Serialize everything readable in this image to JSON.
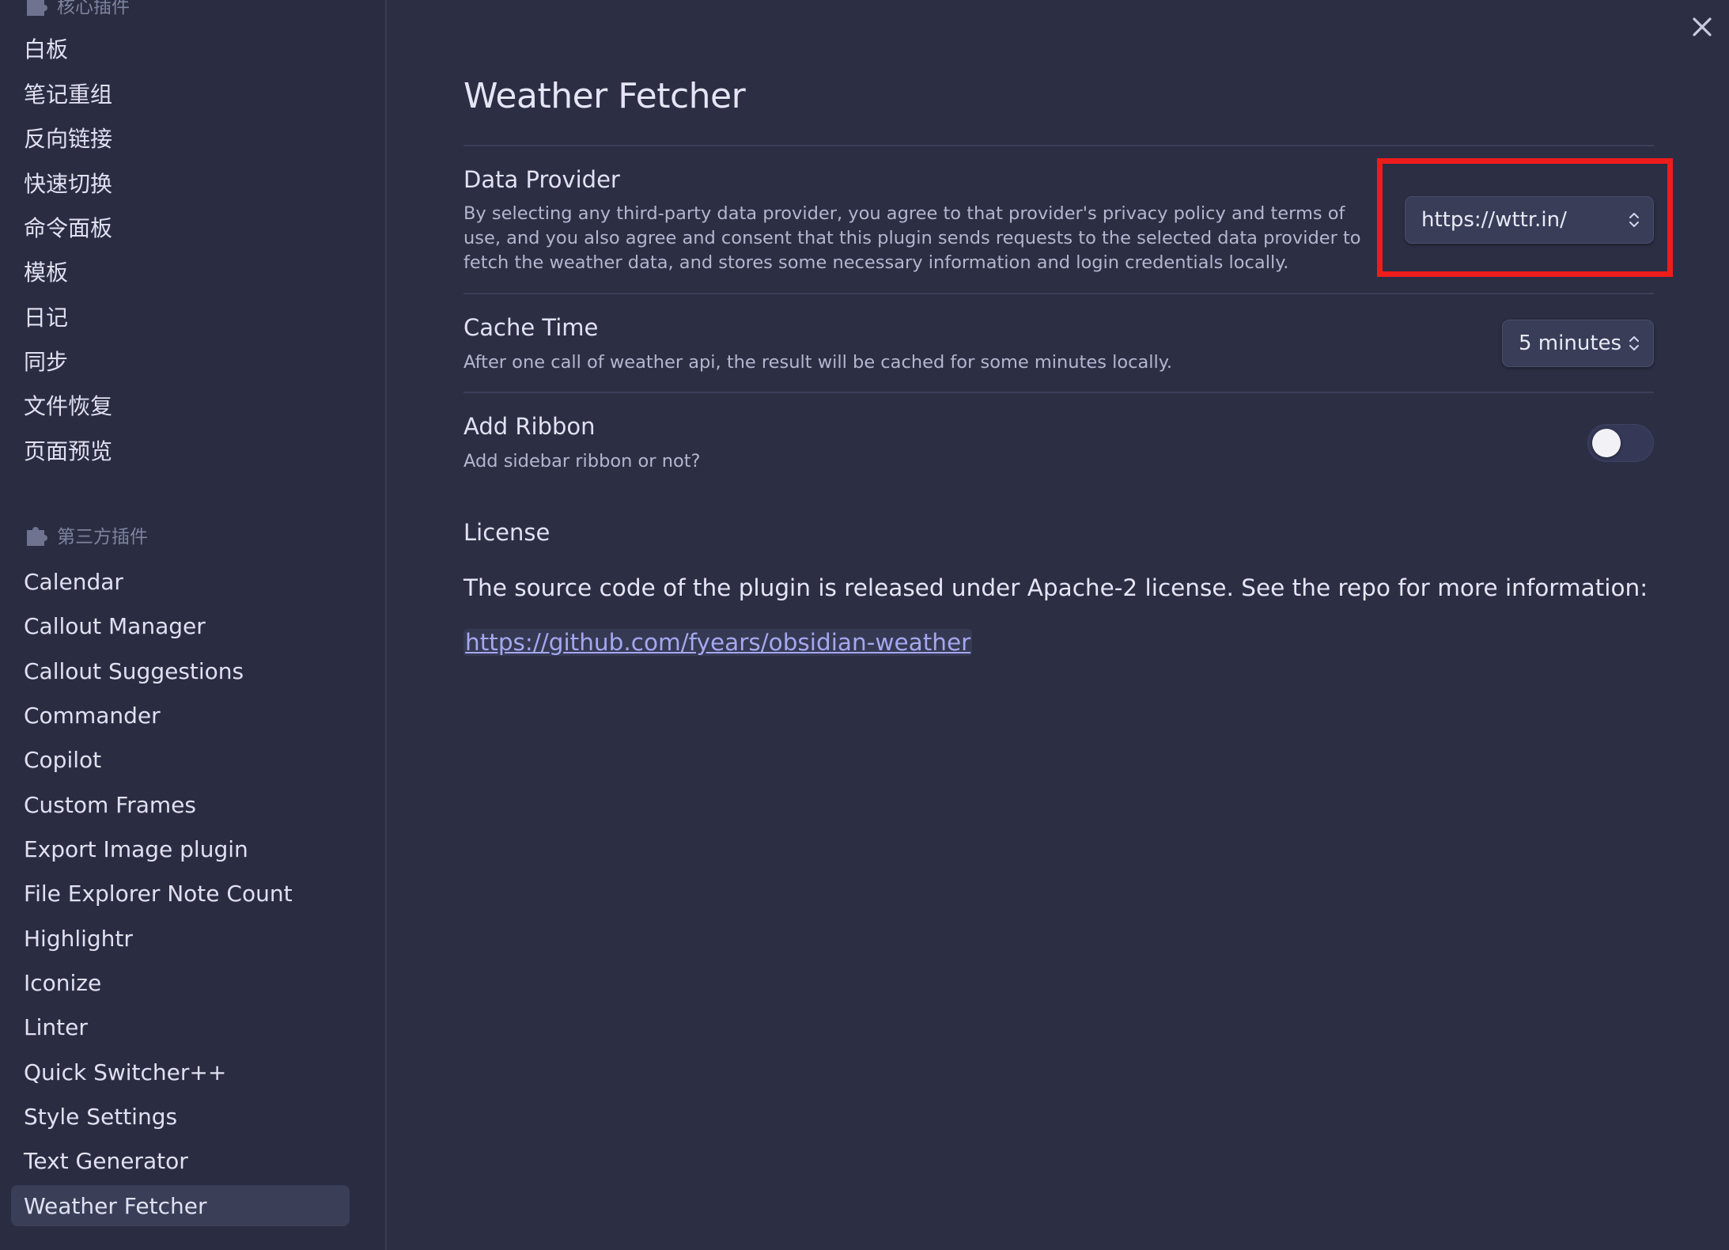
{
  "sidebar": {
    "core_section_label": "核心插件",
    "core_items": [
      {
        "label": "白板"
      },
      {
        "label": "笔记重组"
      },
      {
        "label": "反向链接"
      },
      {
        "label": "快速切换"
      },
      {
        "label": "命令面板"
      },
      {
        "label": "模板"
      },
      {
        "label": "日记"
      },
      {
        "label": "同步"
      },
      {
        "label": "文件恢复"
      },
      {
        "label": "页面预览"
      }
    ],
    "community_section_label": "第三方插件",
    "community_items": [
      {
        "label": "Calendar"
      },
      {
        "label": "Callout Manager"
      },
      {
        "label": "Callout Suggestions"
      },
      {
        "label": "Commander"
      },
      {
        "label": "Copilot"
      },
      {
        "label": "Custom Frames"
      },
      {
        "label": "Export Image plugin"
      },
      {
        "label": "File Explorer Note Count"
      },
      {
        "label": "Highlightr"
      },
      {
        "label": "Iconize"
      },
      {
        "label": "Linter"
      },
      {
        "label": "Quick Switcher++"
      },
      {
        "label": "Style Settings"
      },
      {
        "label": "Text Generator"
      },
      {
        "label": "Weather Fetcher",
        "active": true
      }
    ]
  },
  "main": {
    "title": "Weather Fetcher",
    "settings": {
      "data_provider": {
        "name": "Data Provider",
        "description": "By selecting any third-party data provider, you agree to that provider's privacy policy and terms of use, and you also agree and consent that this plugin sends requests to the selected data provider to fetch the weather data, and stores some necessary information and login credentials locally.",
        "value": "https://wttr.in/"
      },
      "cache_time": {
        "name": "Cache Time",
        "description": "After one call of weather api, the result will be cached for some minutes locally.",
        "value": "5 minutes"
      },
      "add_ribbon": {
        "name": "Add Ribbon",
        "description": "Add sidebar ribbon or not?",
        "enabled": false
      }
    },
    "license": {
      "heading": "License",
      "text": "The source code of the plugin is released under Apache-2 license. See the repo for more information:",
      "link": "https://github.com/fyears/obsidian-weather"
    }
  },
  "colors": {
    "background": "#2c2e44",
    "sidebar_background": "#2a2c41",
    "highlight_box": "#ee1c1c",
    "link": "#a4a8f0"
  },
  "icons": {
    "section": "puzzle-icon",
    "close": "close-icon",
    "dropdown": "chevron-updown-icon"
  }
}
